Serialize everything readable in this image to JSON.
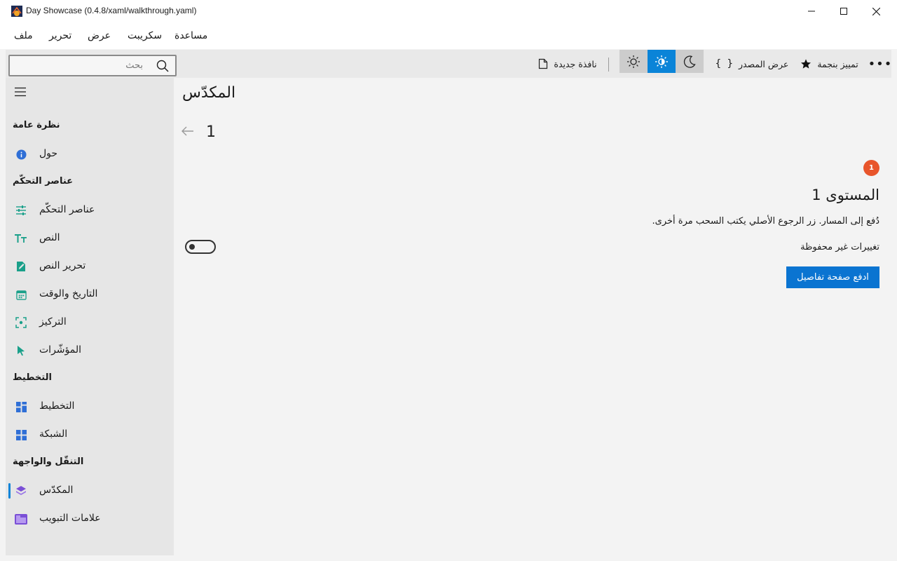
{
  "window": {
    "title": "Day Showcase (0.4.8/xaml/walkthrough.yaml)"
  },
  "menu": {
    "file": "ملف",
    "edit": "تحرير",
    "view": "عرض",
    "script": "سكريبت",
    "help": "مساعدة"
  },
  "search": {
    "placeholder": "بحث",
    "value": ""
  },
  "toolbar": {
    "new_window": "نافذة جديدة",
    "view_source": "عرض المصدر",
    "star": "تمييز بنجمة",
    "theme_selected": "auto"
  },
  "sidebar": {
    "sections": [
      {
        "header": "نظرة عامة",
        "items": [
          {
            "label": "حول",
            "icon": "info-icon"
          }
        ]
      },
      {
        "header": "عناصر التحكّم",
        "items": [
          {
            "label": "عناصر التحكّم",
            "icon": "sliders-icon"
          },
          {
            "label": "النص",
            "icon": "text-size-icon"
          },
          {
            "label": "تحرير النص",
            "icon": "edit-document-icon"
          },
          {
            "label": "التاريخ والوقت",
            "icon": "calendar-icon"
          },
          {
            "label": "التركيز",
            "icon": "focus-icon"
          },
          {
            "label": "المؤشّرات",
            "icon": "pointer-icon"
          }
        ]
      },
      {
        "header": "التخطيط",
        "items": [
          {
            "label": "التخطيط",
            "icon": "layout-icon"
          },
          {
            "label": "الشبكة",
            "icon": "grid-icon"
          }
        ]
      },
      {
        "header": "التنقّل والواجهة",
        "items": [
          {
            "label": "المكدّس",
            "icon": "stack-icon",
            "selected": true
          },
          {
            "label": "علامات التبويب",
            "icon": "tabs-icon"
          }
        ]
      }
    ]
  },
  "main": {
    "title": "المكدّس",
    "page_index": "1",
    "badge": "1",
    "level_title": "المستوى 1",
    "description": "دُفع إلى المسار. زر الرجوع الأصلي يكتب السحب مرة أخرى.",
    "unsaved_label": "تغييرات غير محفوظة",
    "unsaved_on": false,
    "push_button": "ادفع صفحة تفاصيل"
  },
  "colors": {
    "accent": "#0a74d1",
    "badge": "#e8552b",
    "icon_teal": "#1aa08a",
    "icon_blue": "#2f6fd6",
    "icon_purple": "#7a4fd6"
  }
}
